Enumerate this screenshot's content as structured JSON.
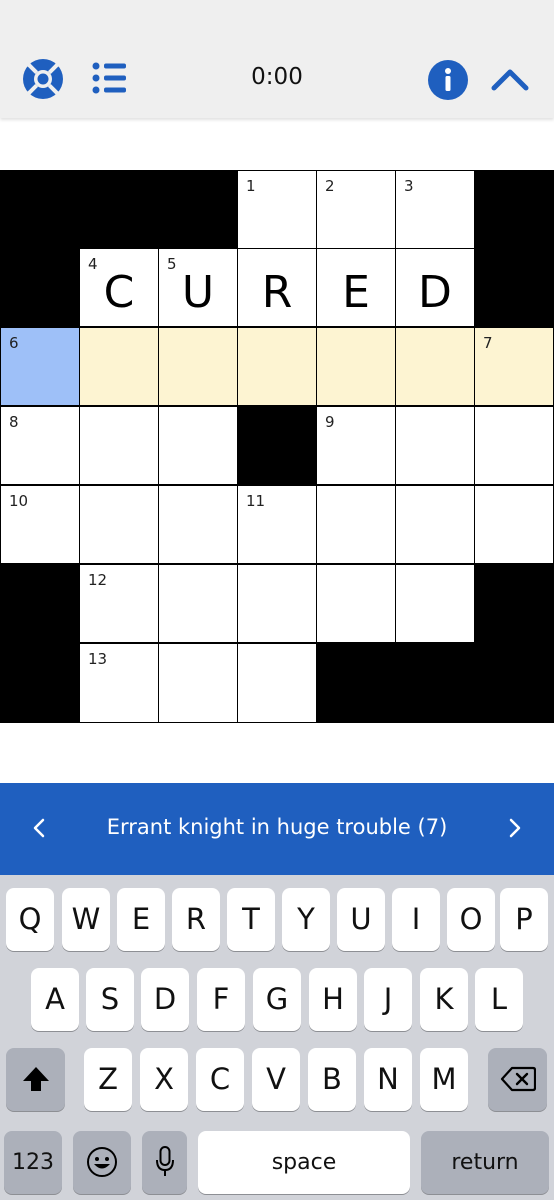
{
  "header": {
    "timer": "0:00",
    "icons": [
      "help-ring-icon",
      "list-icon",
      "info-icon",
      "chevron-up-icon"
    ],
    "accent": "#1f5fbf"
  },
  "grid": {
    "numbers": {
      "n1": "1",
      "n2": "2",
      "n3": "3",
      "n4": "4",
      "n5": "5",
      "n6": "6",
      "n7": "7",
      "n8": "8",
      "n9": "9",
      "n10": "10",
      "n11": "11",
      "n12": "12",
      "n13": "13"
    },
    "letters": {
      "r1c1": "C",
      "r1c2": "U",
      "r1c3": "R",
      "r1c4": "E",
      "r1c5": "D"
    },
    "highlight_color": "#fdf4d2",
    "selected_color": "#9ec0f8"
  },
  "clue": {
    "text": "Errant knight in huge trouble (7)",
    "prev_icon": "chevron-left-icon",
    "next_icon": "chevron-right-icon"
  },
  "keyboard": {
    "row1": [
      "Q",
      "W",
      "E",
      "R",
      "T",
      "Y",
      "U",
      "I",
      "O",
      "P"
    ],
    "row2": [
      "A",
      "S",
      "D",
      "F",
      "G",
      "H",
      "J",
      "K",
      "L"
    ],
    "row3": [
      "Z",
      "X",
      "C",
      "V",
      "B",
      "N",
      "M"
    ],
    "numbers_label": "123",
    "space_label": "space",
    "return_label": "return"
  }
}
